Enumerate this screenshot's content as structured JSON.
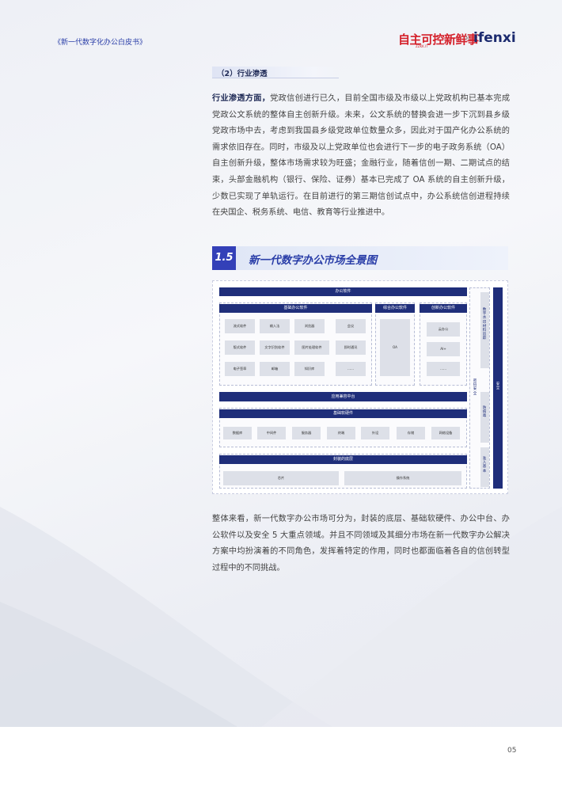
{
  "header": {
    "doc_title": "《新一代数字化办公白皮书》",
    "logo_left": "自主可控新鲜事",
    "logo_left_sub": "ZZKK.IT",
    "logo_sep": "×",
    "logo_right": "ifenxi"
  },
  "subheading": "（2）行业渗透",
  "para1": {
    "bold": "行业渗透方面，",
    "text": "党政信创进行已久，目前全国市级及市级以上党政机构已基本完成党政公文系统的整体自主创新升级。未来，公文系统的替换会进一步下沉到县乡级党政市场中去，考虑到我国县乡级党政单位数量众多，因此对于国产化办公系统的需求依旧存在。同时，市级及以上党政单位也会进行下一步的电子政务系统（OA）自主创新升级，整体市场需求较为旺盛；金融行业，随着信创一期、二期试点的结束，头部金融机构（银行、保险、证券）基本已完成了 OA 系统的自主创新升级，少数已实现了单轨运行。在目前进行的第三期信创试点中，办公系统信创进程持续在央国企、税务系统、电信、教育等行业推进中。"
  },
  "section": {
    "number": "1.5",
    "title": "新一代数字办公市场全景图"
  },
  "diagram": {
    "office_software": "办公软件",
    "basic_office": "基础办公软件",
    "basic_items": [
      "流式软件",
      "输入法",
      "浏览器",
      "会议",
      "版式软件",
      "文字识别软件",
      "图片处理软件",
      "即时通讯",
      "电子签章",
      "邮箱",
      "知识库",
      "......"
    ],
    "integrated_office": "综合办公软件",
    "integrated_item": "OA",
    "innovative_office": "创新办公软件",
    "innovative_items": [
      "云办公",
      "AI+",
      "......"
    ],
    "app_middle": "应用兼容中台",
    "basic_hw_sw": "基础软硬件",
    "hw_items": [
      "数据库",
      "中间件",
      "服务器",
      "终端",
      "外设",
      "存储",
      "网络设备"
    ],
    "base_layer": "封装的底层",
    "base_items": [
      "芯片",
      "操作系统"
    ],
    "side_data": "数字水印材料追踪",
    "side_password": "密码安全",
    "side_virus": "防病毒",
    "side_access": "准入基本",
    "security": "安全"
  },
  "para2": "整体来看，新一代数字办公市场可分为，封装的底层、基础软硬件、办公中台、办公软件以及安全 5 大重点领域。并且不同领域及其细分市场在新一代数字办公解决方案中均扮演着的不同角色，发挥着特定的作用，同时也都面临着各自的信创转型过程中的不同挑战。",
  "page_number": "05"
}
